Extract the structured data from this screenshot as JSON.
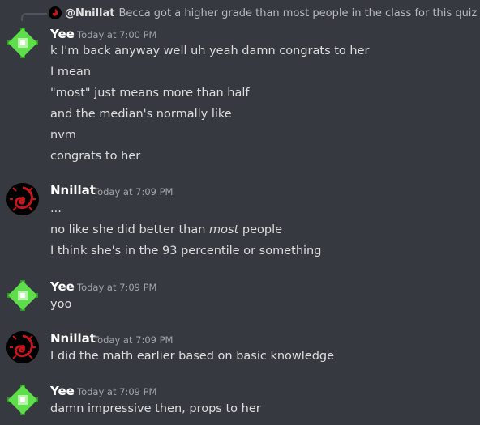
{
  "reply": {
    "user": "@Nnillat",
    "content": "Becca got a higher grade than most people in the class for this quiz"
  },
  "groups": [
    {
      "author": "Yee",
      "time": "Today at 7:00 PM",
      "lines": [
        "k I'm back anyway well uh yeah damn congrats to her",
        "I mean",
        "\"most\" just means more than half",
        "and the median's normally like",
        "nvm",
        "congrats to her"
      ]
    },
    {
      "author": "Nnillat",
      "time": "Today at 7:09 PM",
      "lines": [
        "...",
        "no like she did better than ",
        "most",
        " people",
        "I think she's in the 93 percentile or something"
      ]
    },
    {
      "author": "Yee",
      "time": "Today at 7:09 PM",
      "lines": [
        "yoo"
      ]
    },
    {
      "author": "Nnillat",
      "time": "Today at 7:09 PM",
      "lines": [
        "I did the math earlier based on basic knowledge"
      ]
    },
    {
      "author": "Yee",
      "time": "Today at 7:09 PM",
      "lines": [
        "damn impressive then, props to her"
      ]
    }
  ],
  "icons": {
    "yee_avatar": "green-diamond-icon",
    "nnillat_avatar": "red-dragon-icon"
  },
  "colors": {
    "background": "#36393f",
    "text": "#dcddde",
    "username": "#ffffff",
    "timestamp": "#a3a6aa",
    "avatar_green": "#5dde4a",
    "avatar_dragon": "#c4161c"
  }
}
